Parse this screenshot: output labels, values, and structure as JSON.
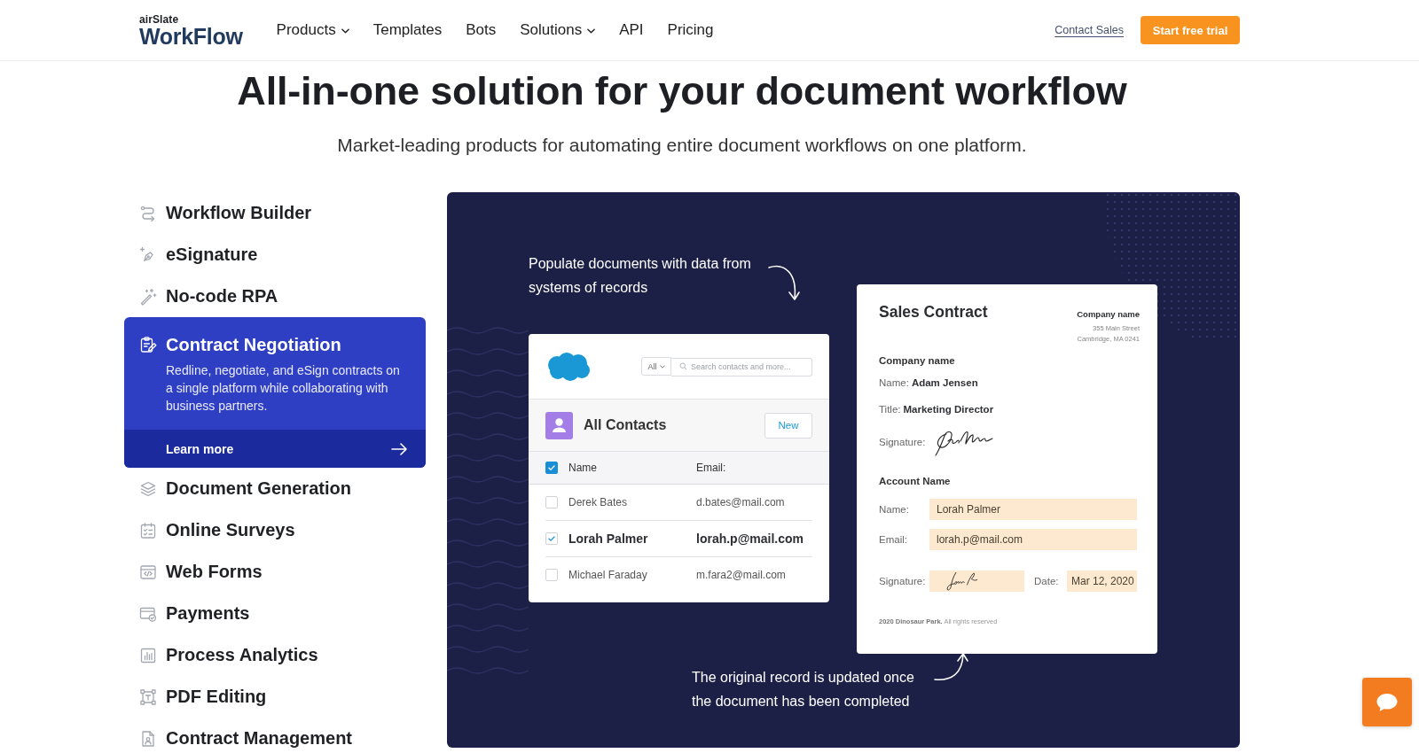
{
  "header": {
    "logo": {
      "brand": "airSlate",
      "product": "WorkFlow"
    },
    "nav": [
      {
        "label": "Products",
        "has_menu": true
      },
      {
        "label": "Templates",
        "has_menu": false
      },
      {
        "label": "Bots",
        "has_menu": false
      },
      {
        "label": "Solutions",
        "has_menu": true
      },
      {
        "label": "API",
        "has_menu": false
      },
      {
        "label": "Pricing",
        "has_menu": false
      }
    ],
    "contact_link": "Contact Sales",
    "cta_button": "Start free trial"
  },
  "hero": {
    "title": "All-in-one solution for your document workflow",
    "subtitle": "Market-leading products for automating entire document workflows on one platform."
  },
  "products": [
    {
      "label": "Workflow Builder",
      "selected": false
    },
    {
      "label": "eSignature",
      "selected": false
    },
    {
      "label": "No-code RPA",
      "selected": false
    },
    {
      "label": "Contract Negotiation",
      "selected": true,
      "description": "Redline, negotiate, and eSign contracts on a single platform while collaborating with business partners.",
      "link": "Learn more"
    },
    {
      "label": "Document Generation",
      "selected": false
    },
    {
      "label": "Online Surveys",
      "selected": false
    },
    {
      "label": "Web Forms",
      "selected": false
    },
    {
      "label": "Payments",
      "selected": false
    },
    {
      "label": "Process Analytics",
      "selected": false
    },
    {
      "label": "PDF Editing",
      "selected": false
    },
    {
      "label": "Contract Management",
      "selected": false
    }
  ],
  "illustration": {
    "annotations": [
      {
        "lines": [
          "Populate documents with data from",
          "systems of records"
        ]
      },
      {
        "lines": [
          "The original record is updated once",
          "the document has been completed"
        ]
      }
    ],
    "contacts_card": {
      "filter": "All",
      "search_placeholder": "Search contacts and more...",
      "title": "All Contacts",
      "new_button": "New",
      "columns": [
        "Name",
        "Email:"
      ],
      "header_checked": true,
      "rows": [
        {
          "name": "Derek Bates",
          "email": "d.bates@mail.com",
          "checked": false
        },
        {
          "name": "Lorah Palmer",
          "email": "lorah.p@mail.com",
          "checked": true
        },
        {
          "name": "Michael Faraday",
          "email": "m.fara2@mail.com",
          "checked": false
        }
      ]
    },
    "contract": {
      "title": "Sales Contract",
      "company_label": "Company name",
      "address_lines": [
        "355 Main Street",
        "Cambridge, MA 0241"
      ],
      "sections": [
        {
          "kind": "plain",
          "heading": "Company name",
          "fields": [
            {
              "kind": "text",
              "label": "Name:",
              "value": "Adam Jensen"
            },
            {
              "kind": "text",
              "label": "Title:",
              "value": "Marketing Director"
            },
            {
              "kind": "signature",
              "label": "Signature:"
            }
          ]
        },
        {
          "kind": "form",
          "heading": "Account Name",
          "fields": [
            {
              "kind": "text",
              "label": "Name:",
              "value": "Lorah Palmer"
            },
            {
              "kind": "text",
              "label": "Email:",
              "value": "lorah.p@mail.com"
            },
            {
              "kind": "signature_date",
              "label": "Signature:",
              "date_label": "Date:",
              "date_value": "Mar 12, 2020"
            }
          ]
        }
      ],
      "footer": "**2020 Dinosaur Park.** All rights reserved"
    }
  }
}
